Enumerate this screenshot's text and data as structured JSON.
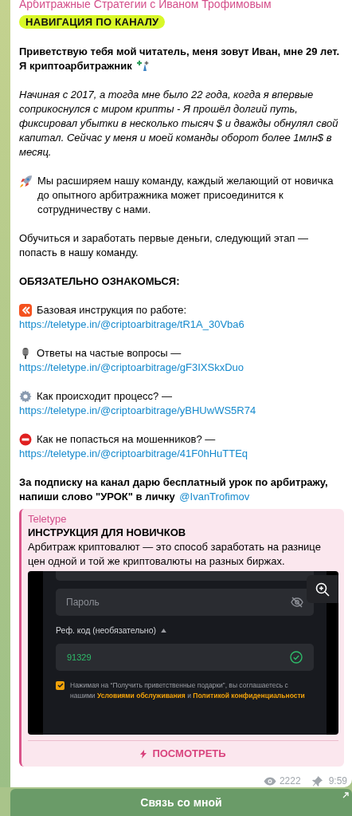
{
  "channel_name": "Арбитражные Стратегии с Иваном Трофимовым",
  "banner": "НАВИГАЦИЯ ПО КАНАЛУ",
  "greeting": [
    "Приветствую тебя мой читатель, меня зовут Иван, мне 29 лет.",
    "Я криптоарбитражник"
  ],
  "intro": "Начиная с 2017, а тогда мне было 22 года, когда я впервые соприкоснулся с миром крипты - Я прошёл долгий путь, фиксировал убытки в несколько тысяч $ и дважды обнулял свой капитал. Сейчас у меня и моей команды оборот более 1млн$ в месяц.",
  "team": "Мы расширяем нашу команду, каждый желающий от новичка до опытного арбитражника может присоединится к сотрудничеству с нами.",
  "next_step": "Обучиться и заработать первые деньги, следующий этап — попасть в нашу команду.",
  "must_read": "ОБЯЗАТЕЛЬНО ОЗНАКОМЬСЯ:",
  "links": [
    {
      "kind": "logo",
      "label": "Базовая инструкция по работе:",
      "url": "https://teletype.in/@criptoarbitrage/tR1A_30Vba6"
    },
    {
      "kind": "microphone",
      "label": "Ответы на частые вопросы —",
      "url": "https://teletype.in/@criptoarbitrage/gF3IXSkxDuo"
    },
    {
      "kind": "gear",
      "label": "Как происходит процесс? —",
      "url": "https://teletype.in/@criptoarbitrage/yBHUwWS5R74"
    },
    {
      "kind": "stop",
      "label": "Как не попасться на мошенников? —",
      "url": "https://teletype.in/@criptoarbitrage/41F0hHuTTEq"
    }
  ],
  "offer": {
    "text": "За подписку на канал дарю бесплатный урок по арбитражу, напиши слово \"УРОК\" в личку",
    "mention": "@IvanTrofimov"
  },
  "preview": {
    "site": "Teletype",
    "title": "ИНСТРУКЦИЯ ДЛЯ НОВИЧКОВ",
    "description": "Арбитраж криптовалют — это способ заработать на разнице цен одной и той же криптовалюты на разных биржах.",
    "screenshot": {
      "password_placeholder": "Пароль",
      "ref_label": "Реф. код (необязательно)",
      "ref_value": "91329",
      "agree_checked": true,
      "agree_text": "Нажимая на “Получить приветственные подарки”, вы соглашаетесь с нашими **Условиями обслуживания** и **Политикой конфиденциальности**"
    },
    "action": "ПОСМОТРЕТЬ"
  },
  "views": "2222",
  "time": "9:59",
  "bottom_button": "Связь со мной"
}
